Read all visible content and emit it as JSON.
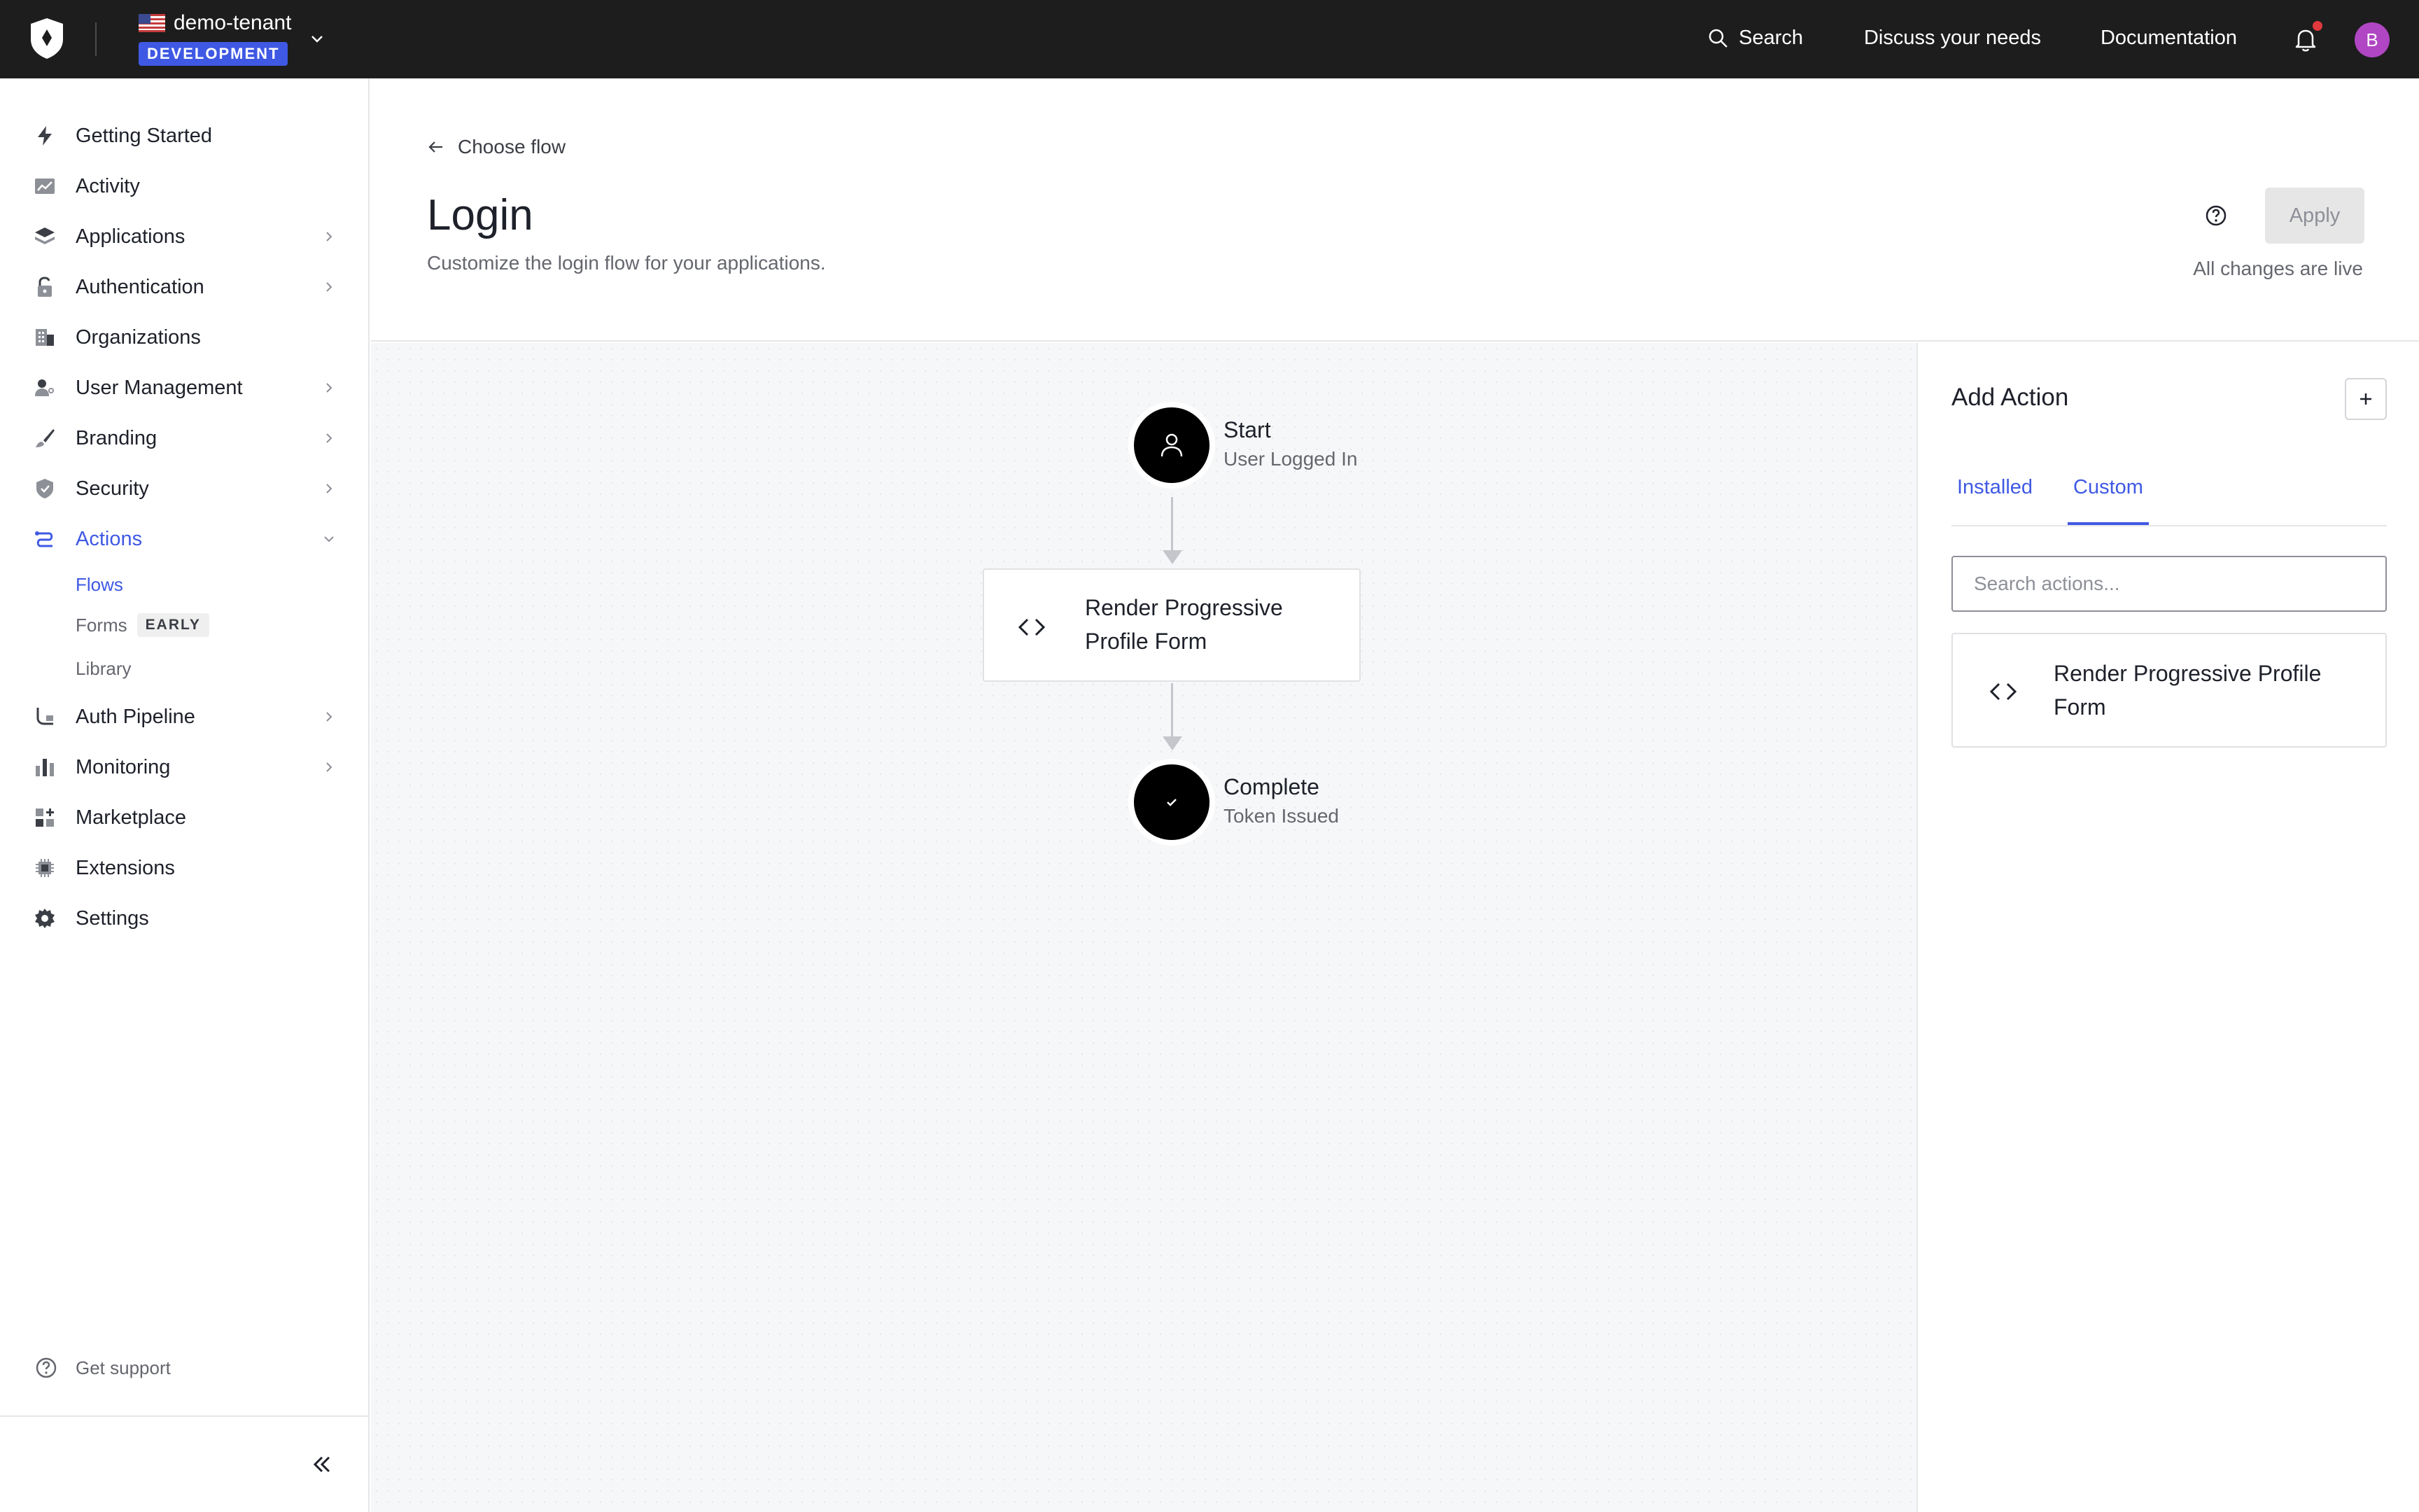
{
  "topbar": {
    "tenant_name": "demo-tenant",
    "environment_badge": "DEVELOPMENT",
    "search_label": "Search",
    "discuss_label": "Discuss your needs",
    "docs_label": "Documentation",
    "avatar_initial": "B",
    "notification_dot_color": "#e0393e",
    "env_badge_color": "#3f59e4"
  },
  "sidebar": {
    "items": [
      {
        "label": "Getting Started",
        "icon": "lightning-icon"
      },
      {
        "label": "Activity",
        "icon": "chart-line-icon"
      },
      {
        "label": "Applications",
        "icon": "layers-icon",
        "chevron": true
      },
      {
        "label": "Authentication",
        "icon": "lock-icon",
        "chevron": true
      },
      {
        "label": "Organizations",
        "icon": "building-icon"
      },
      {
        "label": "User Management",
        "icon": "users-icon",
        "chevron": true
      },
      {
        "label": "Branding",
        "icon": "brush-icon",
        "chevron": true
      },
      {
        "label": "Security",
        "icon": "shield-icon",
        "chevron": true
      },
      {
        "label": "Actions",
        "icon": "flow-icon",
        "chevron": true,
        "active": true
      },
      {
        "label": "Auth Pipeline",
        "icon": "pipeline-icon",
        "chevron": true
      },
      {
        "label": "Monitoring",
        "icon": "bar-chart-icon",
        "chevron": true
      },
      {
        "label": "Marketplace",
        "icon": "grid-plus-icon"
      },
      {
        "label": "Extensions",
        "icon": "chip-icon"
      },
      {
        "label": "Settings",
        "icon": "gear-icon"
      }
    ],
    "sub_items": [
      {
        "label": "Flows",
        "active": true
      },
      {
        "label": "Forms",
        "badge": "EARLY"
      },
      {
        "label": "Library"
      }
    ],
    "support_label": "Get support"
  },
  "header": {
    "back_label": "Choose flow",
    "title": "Login",
    "subtitle": "Customize the login flow for your applications.",
    "apply_label": "Apply",
    "status_text": "All changes are live"
  },
  "flow": {
    "start": {
      "title": "Start",
      "subtitle": "User Logged In"
    },
    "action": {
      "label": "Render Progressive Profile Form"
    },
    "end": {
      "title": "Complete",
      "subtitle": "Token Issued"
    }
  },
  "panel": {
    "title": "Add Action",
    "tabs": [
      {
        "label": "Installed",
        "active": false
      },
      {
        "label": "Custom",
        "active": true
      }
    ],
    "search_placeholder": "Search actions...",
    "actions": [
      {
        "label": "Render Progressive Profile Form",
        "icon": "code-icon"
      }
    ]
  }
}
